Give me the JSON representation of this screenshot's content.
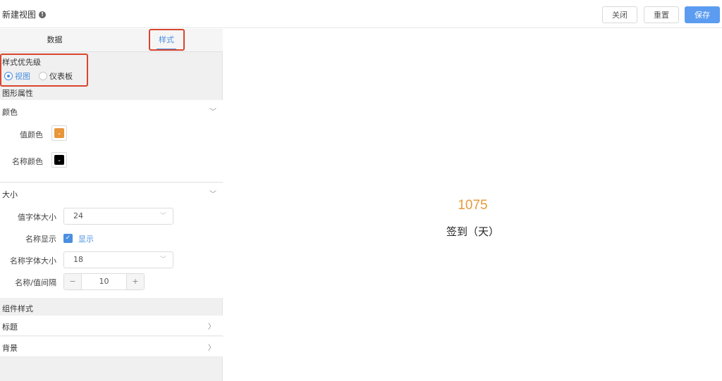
{
  "header": {
    "title": "新建视图",
    "help_icon": "info-circle-icon",
    "close_label": "关闭",
    "reset_label": "重置",
    "save_label": "保存"
  },
  "tabs": [
    {
      "label": "数据",
      "active": false
    },
    {
      "label": "样式",
      "active": true
    }
  ],
  "style_priority": {
    "label": "样式优先级",
    "options": [
      {
        "label": "视图",
        "selected": true
      },
      {
        "label": "仪表板",
        "selected": false
      }
    ]
  },
  "graphic_props": {
    "label": "图形属性",
    "color_section": {
      "title": "颜色",
      "value_color_label": "值颜色",
      "value_color": "#e8963a",
      "name_color_label": "名称颜色",
      "name_color": "#000000"
    },
    "size_section": {
      "title": "大小",
      "value_font_size_label": "值字体大小",
      "value_font_size": "24",
      "name_display_label": "名称显示",
      "name_display_checked": true,
      "name_display_option": "显示",
      "name_font_size_label": "名称字体大小",
      "name_font_size": "18",
      "gap_label": "名称/值间隔",
      "gap_value": "10",
      "decrement": "−",
      "increment": "+"
    }
  },
  "component_style": {
    "label": "组件样式",
    "rows": [
      {
        "label": "标题"
      },
      {
        "label": "背景"
      }
    ]
  },
  "preview": {
    "value": "1075",
    "name": "签到（天）",
    "value_color": "#e89a3c"
  },
  "colors": {
    "accent": "#4a8fe0",
    "save_button": "#5b9cf0",
    "highlight": "#d9452e"
  }
}
